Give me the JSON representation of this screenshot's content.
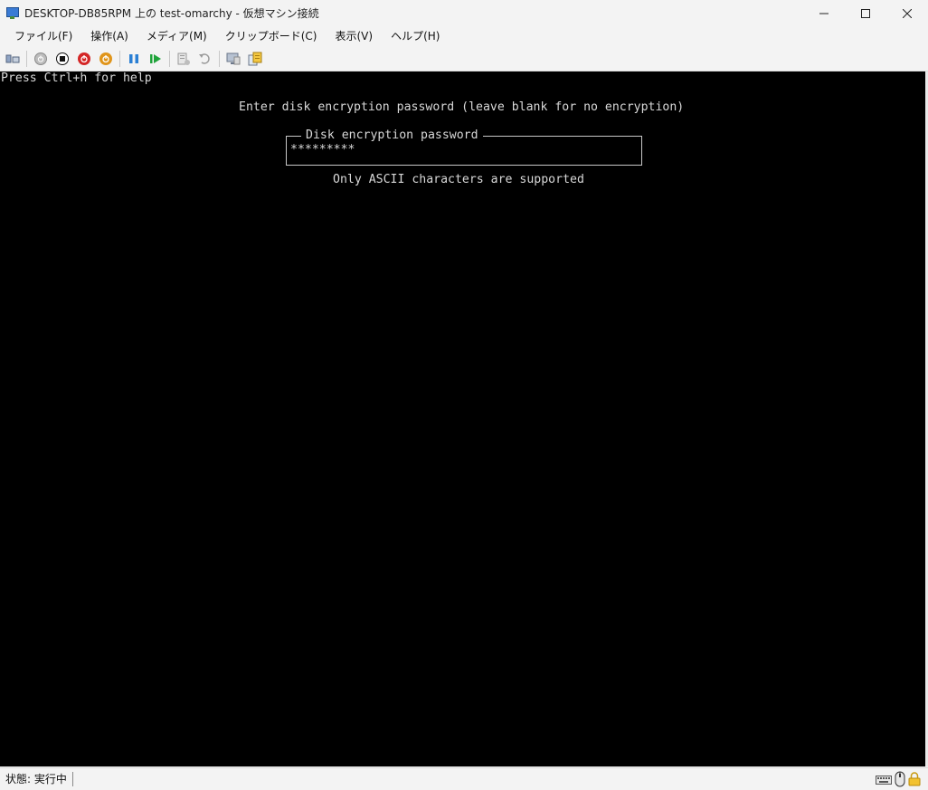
{
  "window": {
    "title": "DESKTOP-DB85RPM 上の test-omarchy  - 仮想マシン接続",
    "icon": "vm-connect-icon",
    "controls": {
      "minimize": "—",
      "maximize": "☐",
      "close": "✕"
    }
  },
  "menu": {
    "items": [
      {
        "label": "ファイル(F)"
      },
      {
        "label": "操作(A)"
      },
      {
        "label": "メディア(M)"
      },
      {
        "label": "クリップボード(C)"
      },
      {
        "label": "表示(V)"
      },
      {
        "label": "ヘルプ(H)"
      }
    ]
  },
  "toolbar": {
    "icons": [
      "ctrl-alt-del-icon",
      "start-icon",
      "turn-off-icon",
      "shutdown-icon",
      "save-state-icon",
      "pause-icon",
      "resume-icon",
      "checkpoint-icon",
      "revert-icon",
      "enhanced-session-icon",
      "share-icon"
    ],
    "colors": {
      "start": "#7a7a7a",
      "stop": "#111111",
      "shutdown": "#d42626",
      "save": "#e0951b",
      "pause": "#2a7fd4",
      "resume": "#1fa33a"
    }
  },
  "console": {
    "help_hint": "Press Ctrl+h for help",
    "prompt": "Enter disk encryption password (leave blank for no encryption)",
    "field_label": "Disk encryption password",
    "field_value": "*********",
    "note": "Only ASCII characters are supported"
  },
  "status": {
    "text": "状態: 実行中",
    "icons": [
      "keyboard-icon",
      "mouse-icon",
      "lock-icon"
    ]
  }
}
